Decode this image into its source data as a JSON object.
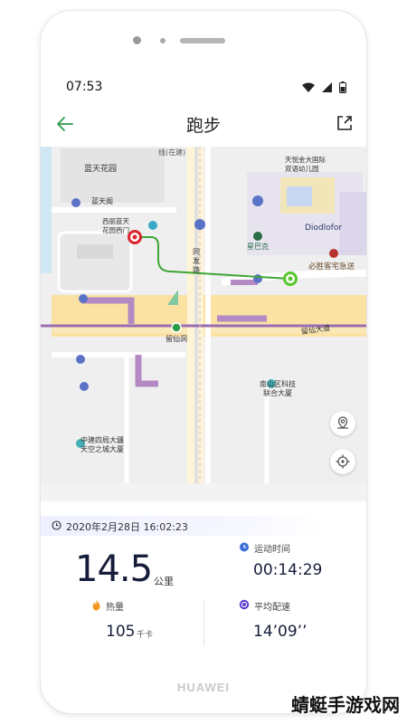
{
  "status_bar": {
    "time": "07:53"
  },
  "header": {
    "title": "跑步"
  },
  "map": {
    "labels": {
      "xian": "线(在建)",
      "lantian_garden": "蓝天花园",
      "lantian_pavilion": "蓝天阁",
      "xili_garden": "西丽蓝天\n花园西门",
      "tongfa_road": "同\n发\n路",
      "liuxiandong": "留仙洞",
      "liuxian_avenue": "留仙大道",
      "nanshan_tech": "南山区科技\n联合大厦",
      "zhongjian": "中建四局大疆\n天空之城大厦",
      "tianyue_top": "天悦金大国际\n双语幼儿园",
      "starbucks": "星巴克",
      "diodlofor": "Diodlofor",
      "bishengke": "必胜客宅急送"
    },
    "route_colors": {
      "start": "#d9252b",
      "end": "#58c72e",
      "path": "#3fa535"
    }
  },
  "summary": {
    "datetime": "2020年2月28日 16:02:23",
    "distance": {
      "value": "14.5",
      "unit": "公里"
    },
    "duration": {
      "label": "运动时间",
      "value": "00:14:29"
    },
    "calories": {
      "label": "热量",
      "value": "105",
      "unit": "千卡"
    },
    "pace": {
      "label": "平均配速",
      "value": "14’09’’"
    }
  },
  "device": {
    "brand": "HUAWEI"
  },
  "watermark": "蜻蜓手游戏网"
}
